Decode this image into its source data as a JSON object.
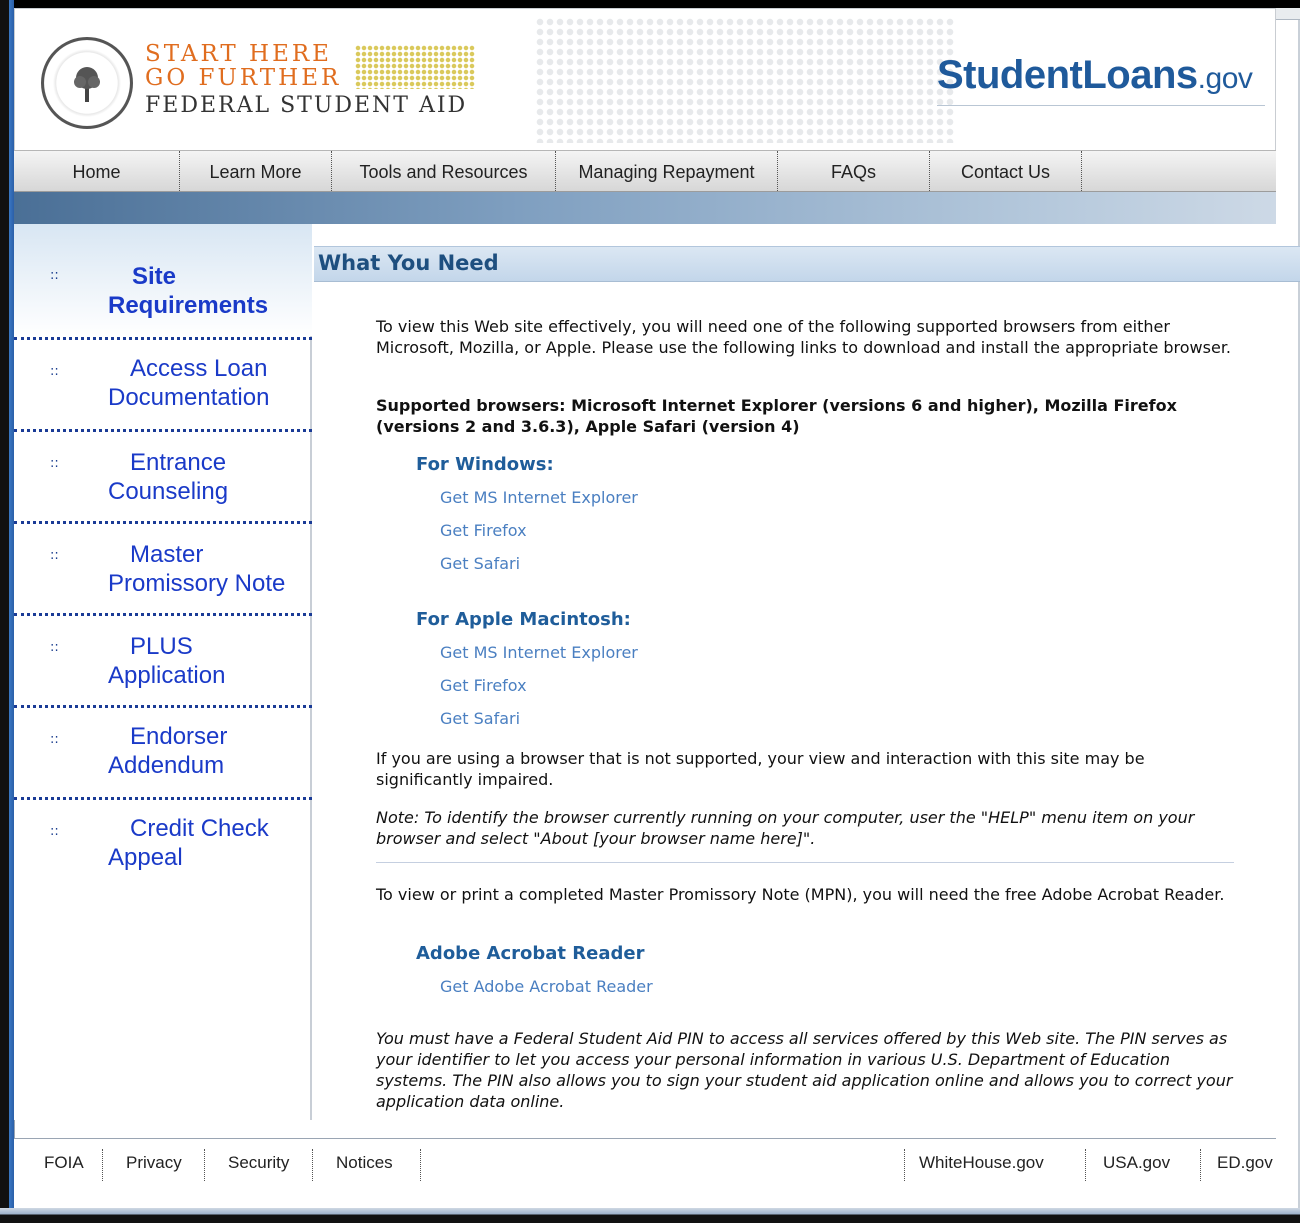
{
  "header": {
    "logo_line1": "START HERE",
    "logo_line2": "GO FURTHER",
    "logo_line3": "FEDERAL STUDENT AID",
    "brand_main": "StudentLoans",
    "brand_suffix": ".gov"
  },
  "nav": {
    "items": [
      "Home",
      "Learn More",
      "Tools and Resources",
      "Managing Repayment",
      "FAQs",
      "Contact Us"
    ]
  },
  "sidebar": {
    "bullet": "::",
    "items": [
      {
        "label": "Site Requirements",
        "active": true
      },
      {
        "label": "Access Loan Documentation"
      },
      {
        "label": "Entrance Counseling"
      },
      {
        "label": "Master Promissory Note"
      },
      {
        "label": "PLUS Application"
      },
      {
        "label": "Endorser Addendum"
      },
      {
        "label": "Credit Check Appeal"
      }
    ]
  },
  "main": {
    "title": "What You Need",
    "intro": "To view this Web site effectively, you will need one of the following supported browsers from either Microsoft, Mozilla, or Apple. Please use the following links to download and install the appropriate browser.",
    "supported": "Supported browsers: Microsoft Internet Explorer (versions 6 and higher), Mozilla Firefox (versions 2 and 3.6.3), Apple Safari (version 4)",
    "windows_heading": "For Windows:",
    "windows_links": [
      "Get MS Internet Explorer",
      "Get Firefox",
      "Get Safari"
    ],
    "mac_heading": "For Apple Macintosh:",
    "mac_links": [
      "Get MS Internet Explorer",
      "Get Firefox",
      "Get Safari"
    ],
    "unsupported": "If you are using a browser that is not supported, your view and interaction with this site may be significantly impaired.",
    "note": "Note: To identify the browser currently running on your computer, user the \"HELP\" menu item on your browser and select \"About [your browser name here]\".",
    "mpn_text": "To view or print a completed Master Promissory Note (MPN), you will need the free Adobe Acrobat Reader.",
    "adobe_heading": "Adobe Acrobat Reader",
    "adobe_link": "Get Adobe Acrobat Reader",
    "pin_text": "You must have a Federal Student Aid PIN to access all services offered by this Web site. The PIN serves as your identifier to let you access your personal information in various U.S. Department of Education systems. The PIN also allows you to sign your student aid application online and allows you to correct your application data online."
  },
  "footer": {
    "left_links": [
      "FOIA",
      "Privacy",
      "Security",
      "Notices"
    ],
    "right_links": [
      "WhiteHouse.gov",
      "USA.gov",
      "ED.gov"
    ]
  }
}
